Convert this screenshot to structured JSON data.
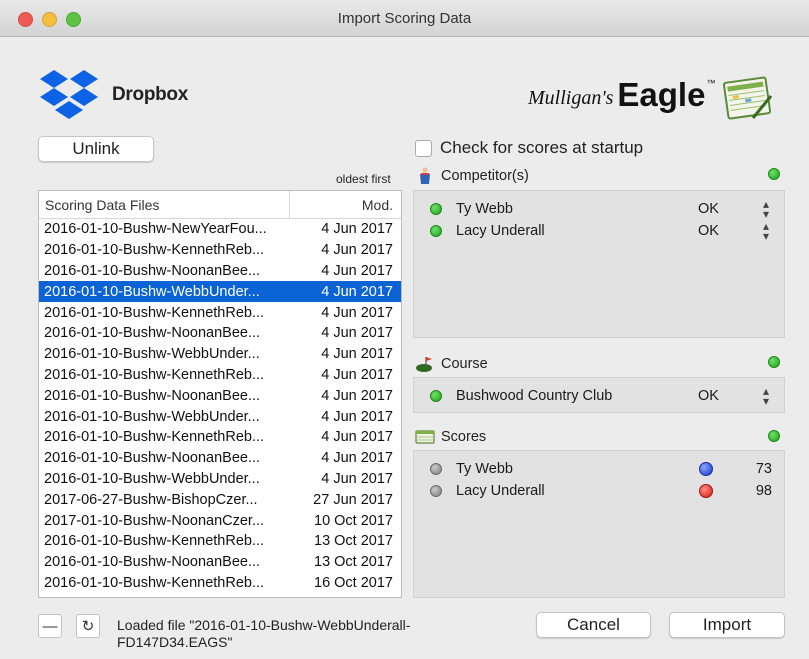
{
  "window": {
    "title": "Import Scoring Data"
  },
  "dropbox": {
    "word": "Dropbox"
  },
  "brand": {
    "small": "Mulligan's",
    "big": "Eagle",
    "tm": "™"
  },
  "buttons": {
    "unlink": "Unlink",
    "cancel": "Cancel",
    "import": "Import",
    "remove": "—",
    "refresh": "↻"
  },
  "startup": {
    "label": "Check for scores at startup",
    "checked": false
  },
  "files": {
    "sort_label": "oldest first",
    "col_name": "Scoring Data Files",
    "col_mod": "Mod.",
    "rows": [
      {
        "name": "2016-01-10-Bushw-NewYearFou...",
        "mod": "4 Jun 2017"
      },
      {
        "name": "2016-01-10-Bushw-KennethReb...",
        "mod": "4 Jun 2017"
      },
      {
        "name": "2016-01-10-Bushw-NoonanBee...",
        "mod": "4 Jun 2017"
      },
      {
        "name": "2016-01-10-Bushw-WebbUnder...",
        "mod": "4 Jun 2017"
      },
      {
        "name": "2016-01-10-Bushw-KennethReb...",
        "mod": "4 Jun 2017"
      },
      {
        "name": "2016-01-10-Bushw-NoonanBee...",
        "mod": "4 Jun 2017"
      },
      {
        "name": "2016-01-10-Bushw-WebbUnder...",
        "mod": "4 Jun 2017"
      },
      {
        "name": "2016-01-10-Bushw-KennethReb...",
        "mod": "4 Jun 2017"
      },
      {
        "name": "2016-01-10-Bushw-NoonanBee...",
        "mod": "4 Jun 2017"
      },
      {
        "name": "2016-01-10-Bushw-WebbUnder...",
        "mod": "4 Jun 2017"
      },
      {
        "name": "2016-01-10-Bushw-KennethReb...",
        "mod": "4 Jun 2017"
      },
      {
        "name": "2016-01-10-Bushw-NoonanBee...",
        "mod": "4 Jun 2017"
      },
      {
        "name": "2016-01-10-Bushw-WebbUnder...",
        "mod": "4 Jun 2017"
      },
      {
        "name": "2017-06-27-Bushw-BishopCzer...",
        "mod": "27 Jun 2017"
      },
      {
        "name": "2017-01-10-Bushw-NoonanCzer...",
        "mod": "10 Oct 2017"
      },
      {
        "name": "2016-01-10-Bushw-KennethReb...",
        "mod": "13 Oct 2017"
      },
      {
        "name": "2016-01-10-Bushw-NoonanBee...",
        "mod": "13 Oct 2017"
      },
      {
        "name": "2016-01-10-Bushw-KennethReb...",
        "mod": "16 Oct 2017"
      }
    ],
    "selected_index": 3
  },
  "competitors": {
    "heading": "Competitor(s)",
    "items": [
      {
        "name": "Ty Webb",
        "status": "OK"
      },
      {
        "name": "Lacy Underall",
        "status": "OK"
      }
    ]
  },
  "course": {
    "heading": "Course",
    "item": {
      "name": "Bushwood Country Club",
      "status": "OK"
    }
  },
  "scores": {
    "heading": "Scores",
    "items": [
      {
        "name": "Ty Webb",
        "score": "73",
        "ball_color": "#1735c8"
      },
      {
        "name": "Lacy Underall",
        "score": "98",
        "ball_color": "#d41c14"
      }
    ]
  },
  "status": {
    "text": "Loaded file \"2016-01-10-Bushw-WebbUnderall-FD147D34.EAGS\""
  },
  "colors": {
    "selection": "#0b63d6",
    "ok_green": "#1da31a",
    "dropbox_blue": "#0d62e6"
  }
}
